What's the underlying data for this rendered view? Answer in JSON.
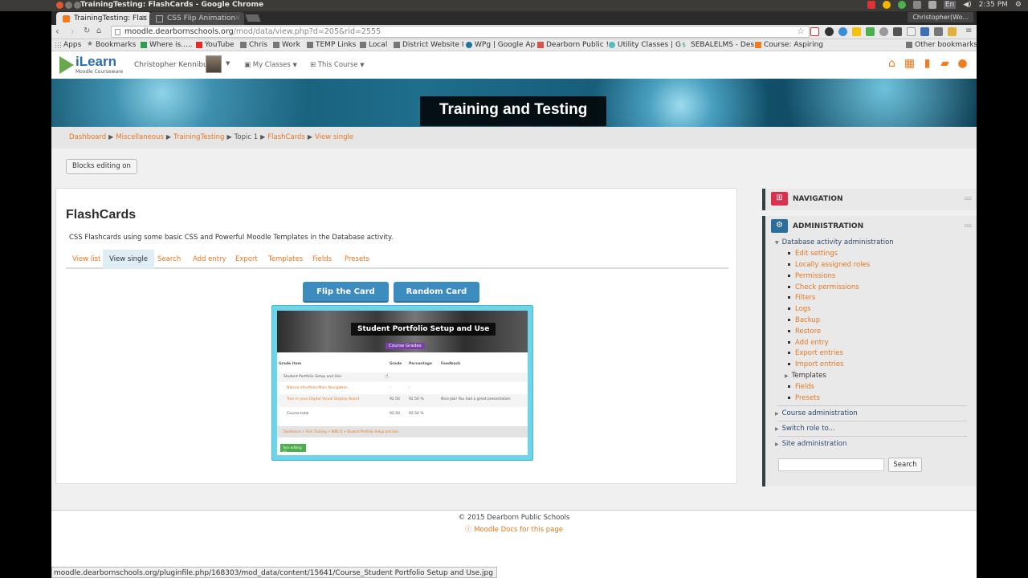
{
  "os": {
    "window_title": "TrainingTesting: FlashCards - Google Chrome",
    "clock": "2:35 PM",
    "keyboard": "En"
  },
  "browser": {
    "tabs": [
      {
        "label": "TrainingTesting: Flas",
        "active": true
      },
      {
        "label": "CSS Flip Animation",
        "active": false
      }
    ],
    "profile": "Christopher(Wo...",
    "url_domain": "moodle.dearbornschools.org",
    "url_path": "/mod/data/view.php?d=205&rid=2555",
    "bookmarks": [
      {
        "label": "Apps",
        "icon": "apps-icon"
      },
      {
        "label": "Bookmarks",
        "icon": "star-icon"
      },
      {
        "label": "Where is.....",
        "icon": "sheet-icon"
      },
      {
        "label": "YouTube",
        "icon": "youtube-icon"
      },
      {
        "label": "Chris",
        "icon": "folder-icon"
      },
      {
        "label": "Work",
        "icon": "folder-icon"
      },
      {
        "label": "TEMP Links",
        "icon": "folder-icon"
      },
      {
        "label": "Local",
        "icon": "folder-icon"
      },
      {
        "label": "District Website I",
        "icon": "folder-icon"
      },
      {
        "label": "WPg | Google Ap",
        "icon": "wordpress-icon"
      },
      {
        "label": "Dearborn Public !",
        "icon": "page-icon"
      },
      {
        "label": "Utility Classes | G",
        "icon": "globe-icon"
      },
      {
        "label": "SEBALELMS - Des",
        "icon": "dollar-icon"
      },
      {
        "label": "Course: Aspiring",
        "icon": "moodle-icon"
      }
    ],
    "other_bookmarks": "Other bookmarks",
    "status_url": "moodle.dearbornschools.org/pluginfile.php/168303/mod_data/content/15641/Course_Student Portfolio Setup and Use.jpg"
  },
  "site": {
    "logo_name": "iLearn",
    "logo_sub": "Moodle Courseware",
    "user_name": "Christopher Kenniburg",
    "menu_my_classes": "My Classes",
    "menu_this_course": "This Course",
    "banner_title": "Training and Testing",
    "accent": "#e87722"
  },
  "breadcrumb": {
    "dashboard": "Dashboard",
    "misc": "Miscellaneous",
    "course": "TrainingTesting",
    "topic": "Topic 1",
    "activity": "FlashCards",
    "current": "View single"
  },
  "editing_button": "Blocks editing on",
  "main": {
    "heading": "FlashCards",
    "intro": "CSS Flashcards using some basic CSS and Powerful Moodle Templates in the Database activity.",
    "tabs": [
      "View list",
      "View single",
      "Search",
      "Add entry",
      "Export",
      "Templates",
      "Fields",
      "Presets"
    ],
    "active_tab": "View single",
    "flip_button": "Flip the Card",
    "random_button": "Random Card",
    "card": {
      "title": "Student Portfolio Setup and Use",
      "badge": "Course Grades",
      "columns": [
        "Grade item",
        "Grade",
        "Percentage",
        "Feedback"
      ],
      "rows": [
        {
          "item": "Student Portfolio Setup and Use",
          "grade": "",
          "pct": "",
          "feedback": ""
        },
        {
          "item": "Nature ePortfolio Main Navigation",
          "grade": "-",
          "pct": "-",
          "feedback": ""
        },
        {
          "item": "Turn in your Digital Visual Display Board",
          "grade": "92.50",
          "pct": "92.50 %",
          "feedback": "Nice Job! You had a great presentation"
        },
        {
          "item": "Course total",
          "grade": "92.50",
          "pct": "92.50 %",
          "feedback": ""
        }
      ],
      "crumb": "Dashboard > Tech Training > WBS Q > Student Portfolio Setup and Use",
      "green_button": "Turn editing on"
    }
  },
  "sidebar": {
    "navigation_title": "NAVIGATION",
    "administration_title": "ADMINISTRATION",
    "db_admin": "Database activity administration",
    "db_links": [
      "Edit settings",
      "Locally assigned roles",
      "Permissions",
      "Check permissions",
      "Filters",
      "Logs",
      "Backup",
      "Restore",
      "Add entry",
      "Export entries",
      "Import entries"
    ],
    "templates": "Templates",
    "db_links_after": [
      "Fields",
      "Presets"
    ],
    "course_admin": "Course administration",
    "switch_role": "Switch role to...",
    "site_admin": "Site administration",
    "search_button": "Search"
  },
  "footer": {
    "copyright": "© 2015 Dearborn Public Schools",
    "docs_link": "Moodle Docs for this page"
  }
}
